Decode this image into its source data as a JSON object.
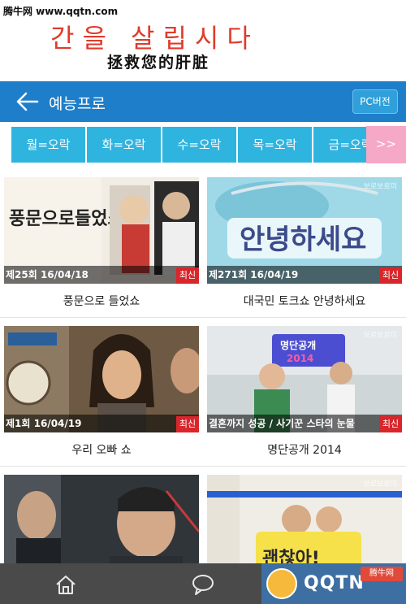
{
  "watermark": "腾牛网 www.qqtn.com",
  "banner": {
    "line1": "간을 살립시다",
    "line2": "拯救您的肝脏"
  },
  "header": {
    "title": "예능프로",
    "pc_button": "PC버전"
  },
  "tabs": [
    {
      "label": "월=오락"
    },
    {
      "label": "화=오락"
    },
    {
      "label": "수=오락"
    },
    {
      "label": "목=오락"
    },
    {
      "label": "금=오락"
    }
  ],
  "tabs_more": ">>",
  "cards": [
    {
      "episode": "제25회 16/04/18",
      "badge": "최신",
      "title": "풍문으로 들었쇼"
    },
    {
      "episode": "제271회 16/04/19",
      "badge": "최신",
      "title": "대국민 토크쇼 안녕하세요"
    },
    {
      "episode": "제1회 16/04/19",
      "badge": "최신",
      "title": "우리 오빠 쇼"
    },
    {
      "episode": "결혼까지 성공 / 사기꾼 스타의 눈물",
      "badge": "최신",
      "title": "명단공개 2014"
    },
    {
      "episode": "",
      "badge": "",
      "title": ""
    },
    {
      "episode": "",
      "badge": "",
      "title": ""
    }
  ],
  "site_mark": "보로보로미",
  "bottom_bar": {
    "qqtn_text": "QQTN",
    "qqtn_badge": "腾牛网"
  },
  "colors": {
    "header_bg": "#1e7ec9",
    "tab_bg": "#2fb4e0",
    "tab_more_bg": "#f5a9c6",
    "badge_bg": "#d9262b",
    "banner_red": "#e03b2b"
  }
}
